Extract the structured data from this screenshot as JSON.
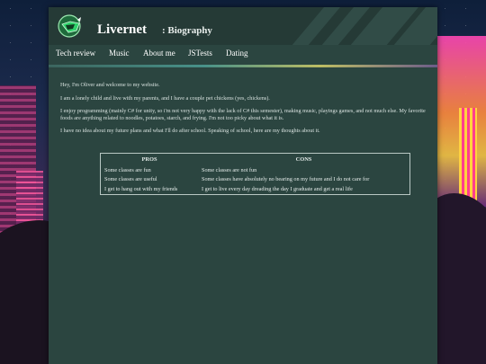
{
  "site": {
    "title": "Livernet",
    "subtitle": ": Biography",
    "logo_icon": "logo-icon",
    "accent_color": "#2b4540"
  },
  "nav": {
    "items": [
      {
        "label": "Tech review"
      },
      {
        "label": "Music"
      },
      {
        "label": "About me"
      },
      {
        "label": "JSTests"
      },
      {
        "label": "Dating"
      }
    ]
  },
  "content": {
    "paragraphs": [
      "Hey, I'm Oliver and welcome to my website.",
      "I am a lonely child and live with my parents, and I have a couple pet chickens (yes, chickens).",
      "I enjoy programming (mainly C# for unity, so i'm not very happy with the lack of C# this semester), making music, playings games, and not much else. My favorite foods are anything related to noodles, potatoes, starch, and frying. I'm not too picky about what it is.",
      "I have no idea about my future plans and what I'll do after school. Speaking of school, here are my thoughts about it."
    ]
  },
  "table": {
    "headers": [
      "PROS",
      "CONS"
    ],
    "rows": [
      [
        "Some classes are fun",
        "Some classes are not fun"
      ],
      [
        "Some classes are useful",
        "Some classes have absolutely no bearing on my future and I do not care for"
      ],
      [
        "I get to hang out with my friends",
        "I get to live every day dreading the day I graduate and get a real life"
      ]
    ]
  }
}
